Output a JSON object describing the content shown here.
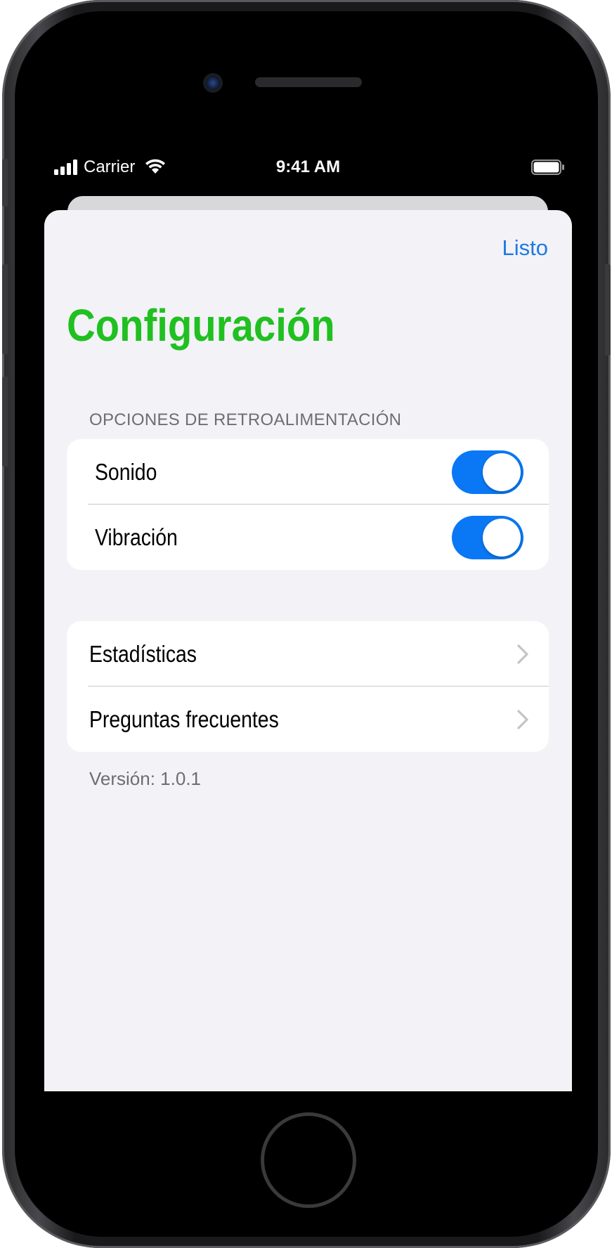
{
  "status_bar": {
    "carrier": "Carrier",
    "time": "9:41 AM"
  },
  "nav_bar": {
    "done_label": "Listo",
    "title": "Configuración"
  },
  "feedback_section": {
    "header": "OPCIONES DE RETROALIMENTACIÓN",
    "items": [
      {
        "label": "Sonido",
        "enabled": true
      },
      {
        "label": "Vibración",
        "enabled": true
      }
    ]
  },
  "nav_section": {
    "items": [
      {
        "label": "Estadísticas"
      },
      {
        "label": "Preguntas frecuentes"
      }
    ]
  },
  "footer": {
    "version": "Versión: 1.0.1"
  },
  "colors": {
    "accent_blue": "#1f7ae0",
    "switch_on": "#0a78f5",
    "title_green": "#20c020",
    "background": "#f2f2f7"
  },
  "icons": {
    "cellular": "cellular-signal-icon",
    "wifi": "wifi-icon",
    "battery": "battery-icon",
    "chevron": "chevron-right-icon"
  }
}
